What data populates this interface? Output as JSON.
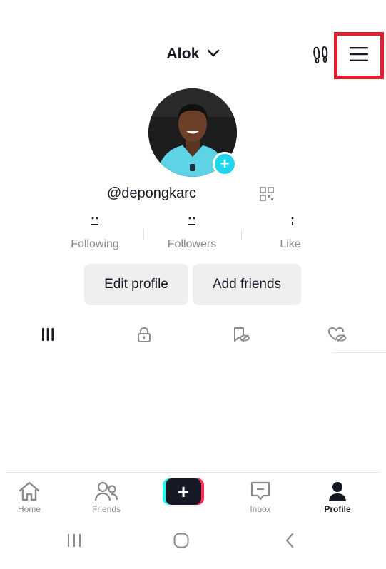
{
  "header": {
    "title": "Alok",
    "title_icon": "chevron-down-icon",
    "left_icon": "footsteps-icon",
    "menu_icon": "hamburger-menu-icon",
    "menu_highlight_color": "#e02030"
  },
  "profile": {
    "username": "@depongkarc",
    "avatar_badge": "+",
    "avatar_badge_color": "#20d5ec",
    "qr_icon": "qr-code-icon"
  },
  "stats": [
    {
      "label": "Following"
    },
    {
      "label": "Followers"
    },
    {
      "label": "Like"
    }
  ],
  "actions": {
    "edit_profile": "Edit profile",
    "add_friends": "Add friends"
  },
  "tabs": [
    {
      "icon": "grid-icon",
      "active": true
    },
    {
      "icon": "lock-icon"
    },
    {
      "icon": "bookmark-hidden-icon"
    },
    {
      "icon": "liked-hidden-icon"
    }
  ],
  "bottom_nav": {
    "home": "Home",
    "friends": "Friends",
    "create": "+",
    "inbox": "Inbox",
    "profile": "Profile"
  },
  "colors": {
    "text": "#161823",
    "secondary": "#8a8b91",
    "button_bg": "#efeff0",
    "create_cyan": "#25f4ee",
    "create_pink": "#fe2c55"
  }
}
